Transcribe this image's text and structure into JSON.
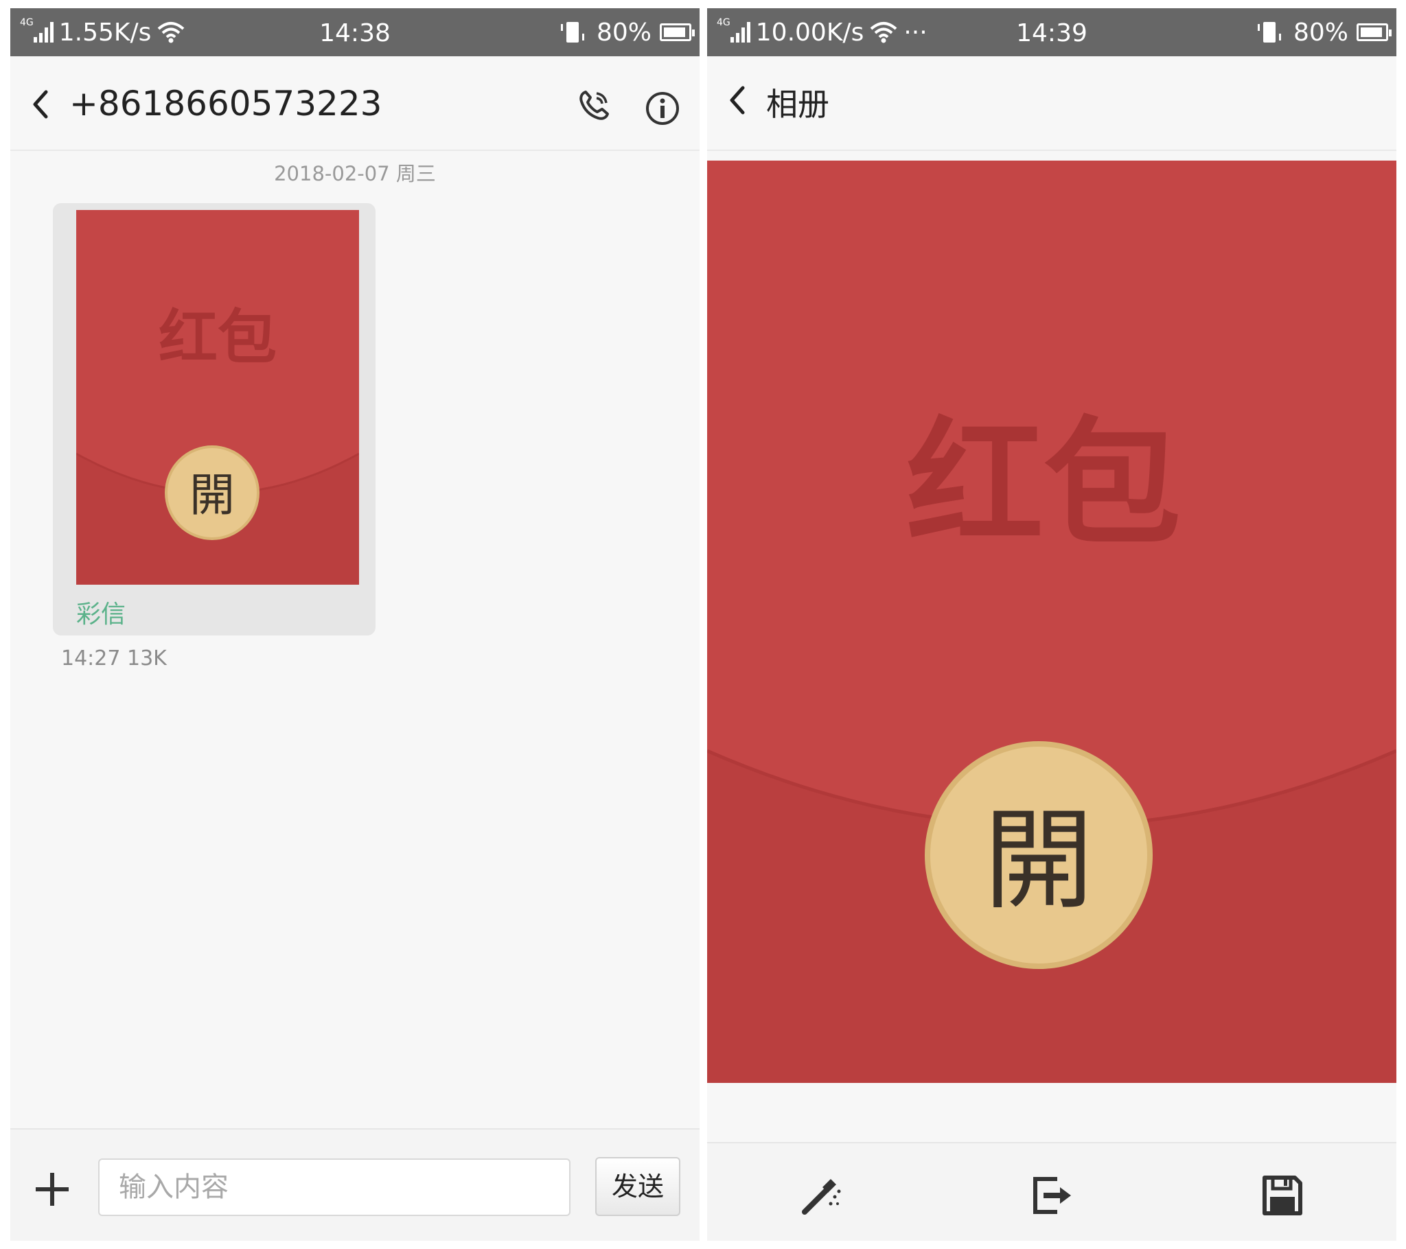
{
  "left_screen": {
    "status_bar": {
      "network": "4G",
      "speed": "1.55K/s",
      "time": "14:38",
      "battery": "80%"
    },
    "header": {
      "title": "+8618660573223",
      "icons": [
        "back-icon",
        "phone-icon",
        "info-icon"
      ]
    },
    "date_separator": "2018-02-07 周三",
    "message": {
      "image_text": "红包",
      "button_text": "開",
      "label": "彩信",
      "meta": "14:27 13K"
    },
    "compose": {
      "placeholder": "输入内容",
      "send_label": "发送",
      "icons": [
        "plus-icon"
      ]
    }
  },
  "right_screen": {
    "status_bar": {
      "network": "4G",
      "speed": "10.00K/s",
      "more": "···",
      "time": "14:39",
      "battery": "80%"
    },
    "header": {
      "title": "相册",
      "icons": [
        "back-icon"
      ]
    },
    "photo": {
      "image_text": "红包",
      "button_text": "開"
    },
    "toolbar": {
      "icons": [
        "magic-wand-icon",
        "share-icon",
        "save-icon"
      ]
    }
  },
  "colors": {
    "status_bar": "#676767",
    "envelope_red": "#c44646",
    "envelope_text": "#a93434",
    "seal_gold": "#e8c88d",
    "mms_label_green": "#5bb28a"
  }
}
